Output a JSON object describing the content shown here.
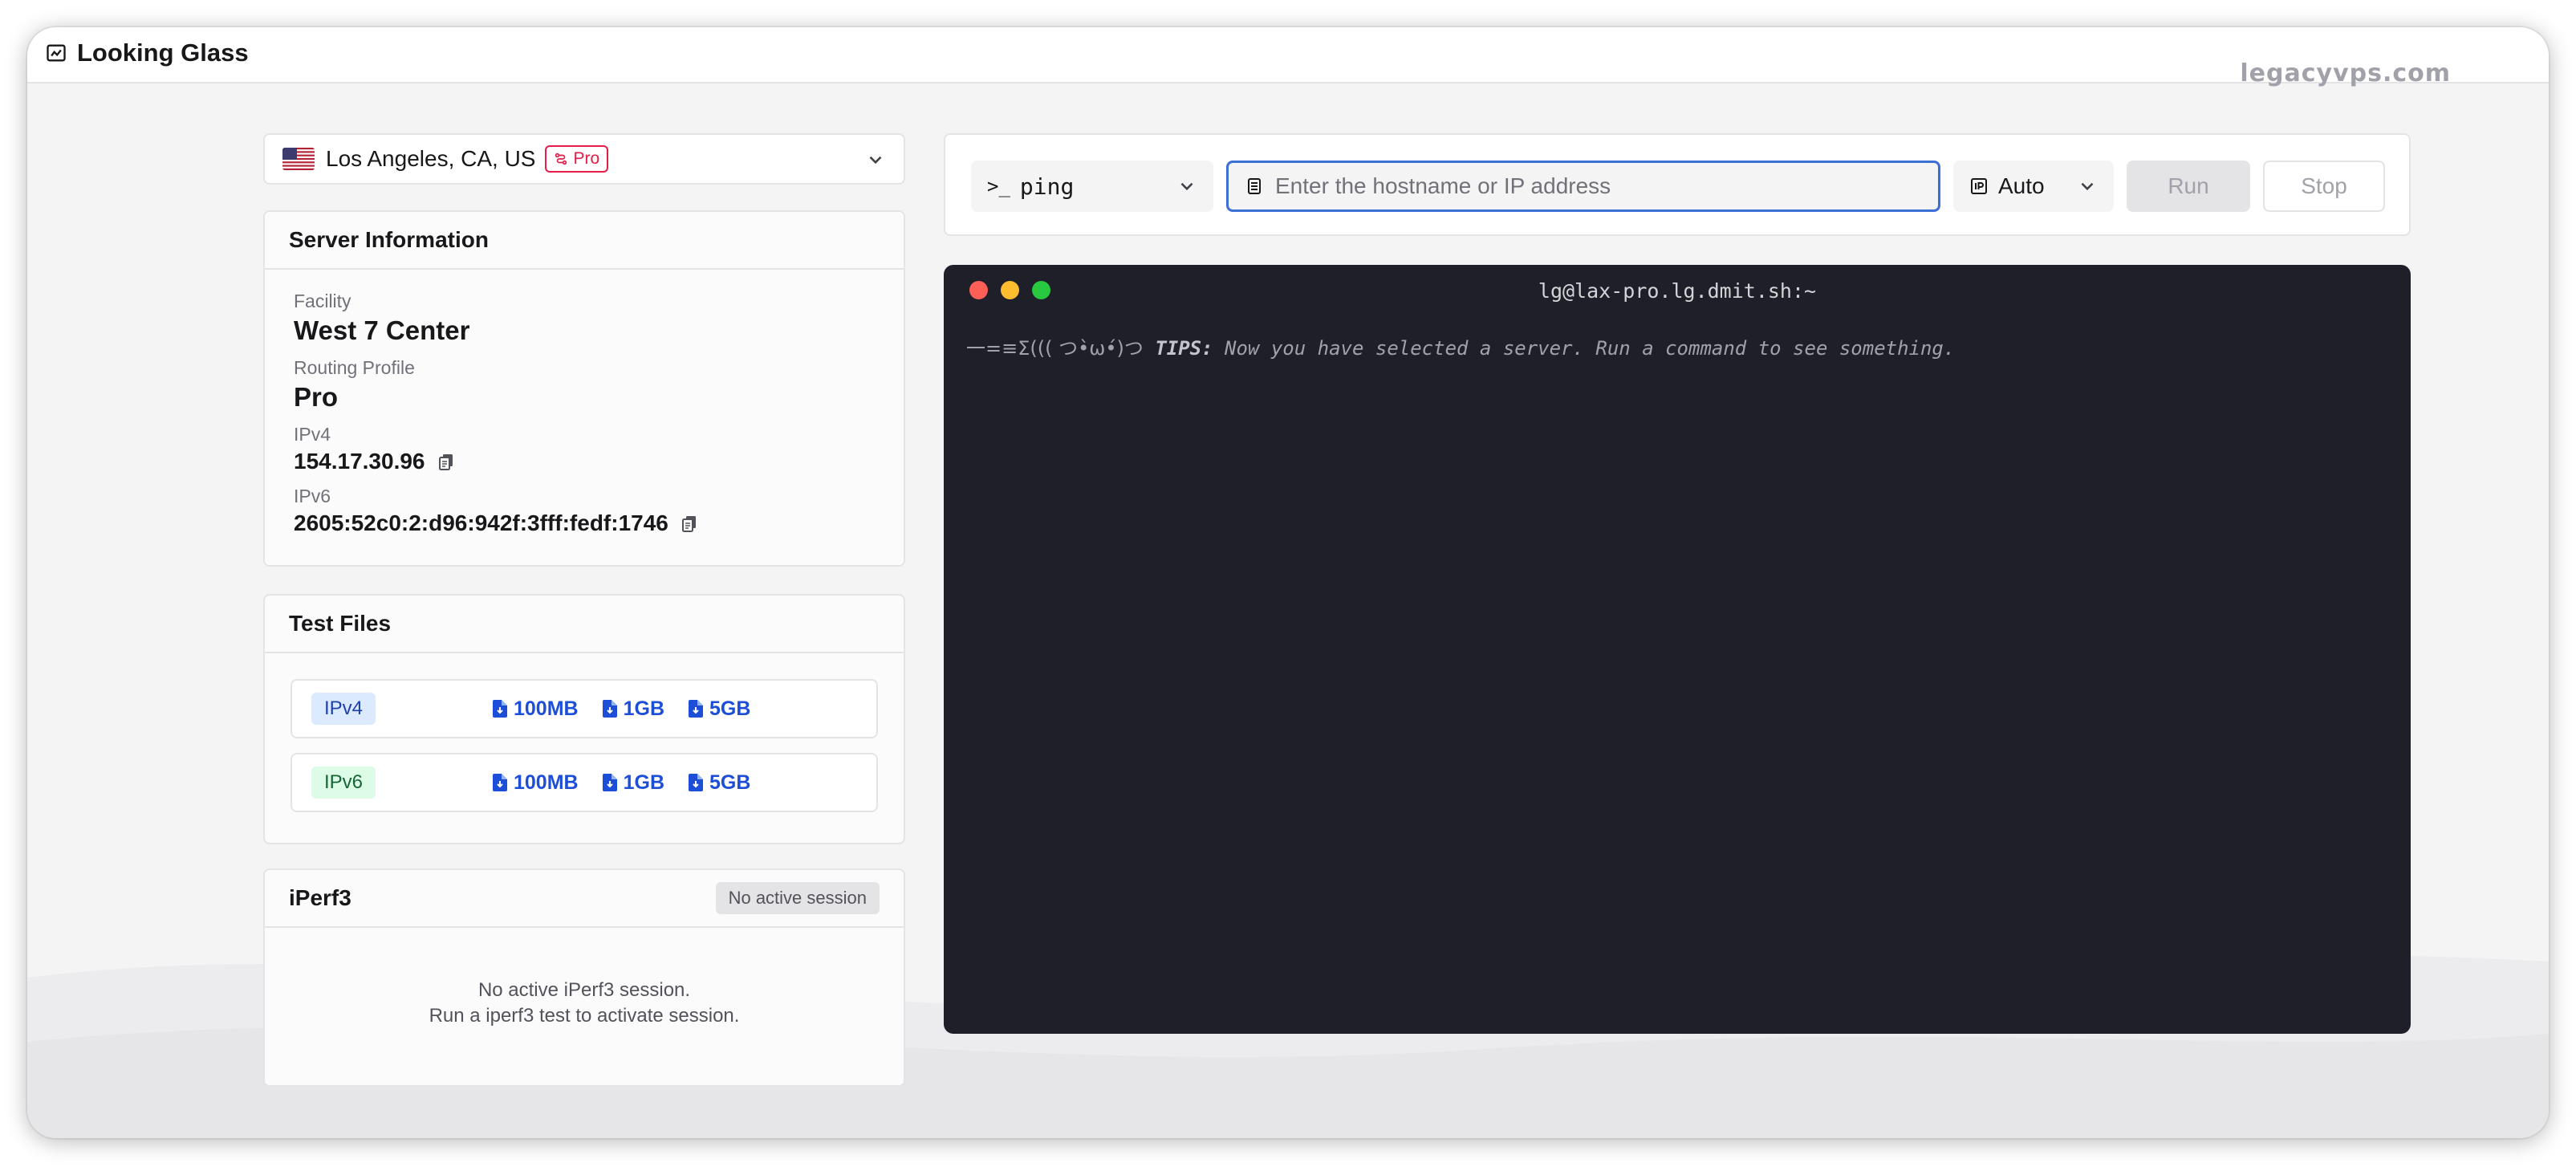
{
  "app": {
    "title": "Looking Glass",
    "watermark": "legacyvps.com"
  },
  "location": {
    "label": "Los Angeles, CA, US",
    "badge": "Pro",
    "flag": "us-flag-icon"
  },
  "server_info": {
    "title": "Server Information",
    "facility_label": "Facility",
    "facility": "West 7 Center",
    "routing_label": "Routing Profile",
    "routing": "Pro",
    "ipv4_label": "IPv4",
    "ipv4": "154.17.30.96",
    "ipv6_label": "IPv6",
    "ipv6": "2605:52c0:2:d96:942f:3fff:fedf:1746"
  },
  "test_files": {
    "title": "Test Files",
    "rows": [
      {
        "version": "IPv4",
        "files": [
          "100MB",
          "1GB",
          "5GB"
        ]
      },
      {
        "version": "IPv6",
        "files": [
          "100MB",
          "1GB",
          "5GB"
        ]
      }
    ]
  },
  "iperf": {
    "title": "iPerf3",
    "status": "No active session",
    "message_line1": "No active iPerf3 session.",
    "message_line2": "Run a iperf3 test to activate session."
  },
  "command_bar": {
    "command": "ping",
    "host_placeholder": "Enter the hostname or IP address",
    "protocol": "Auto",
    "run_label": "Run",
    "stop_label": "Stop"
  },
  "terminal": {
    "title": "lg@lax-pro.lg.dmit.sh:~",
    "prefix": "一=≡Σ((( つ•̀ω•́)つ",
    "tips_label": "TIPS:",
    "tips_text": "Now you have selected a server. Run a command to see something."
  },
  "colors": {
    "accent_blue": "#1d4ed8",
    "pro_badge": "#e11d48",
    "terminal_bg": "#1f1f29",
    "dot_red": "#ff5f57",
    "dot_yellow": "#febc2e",
    "dot_green": "#28c840"
  }
}
